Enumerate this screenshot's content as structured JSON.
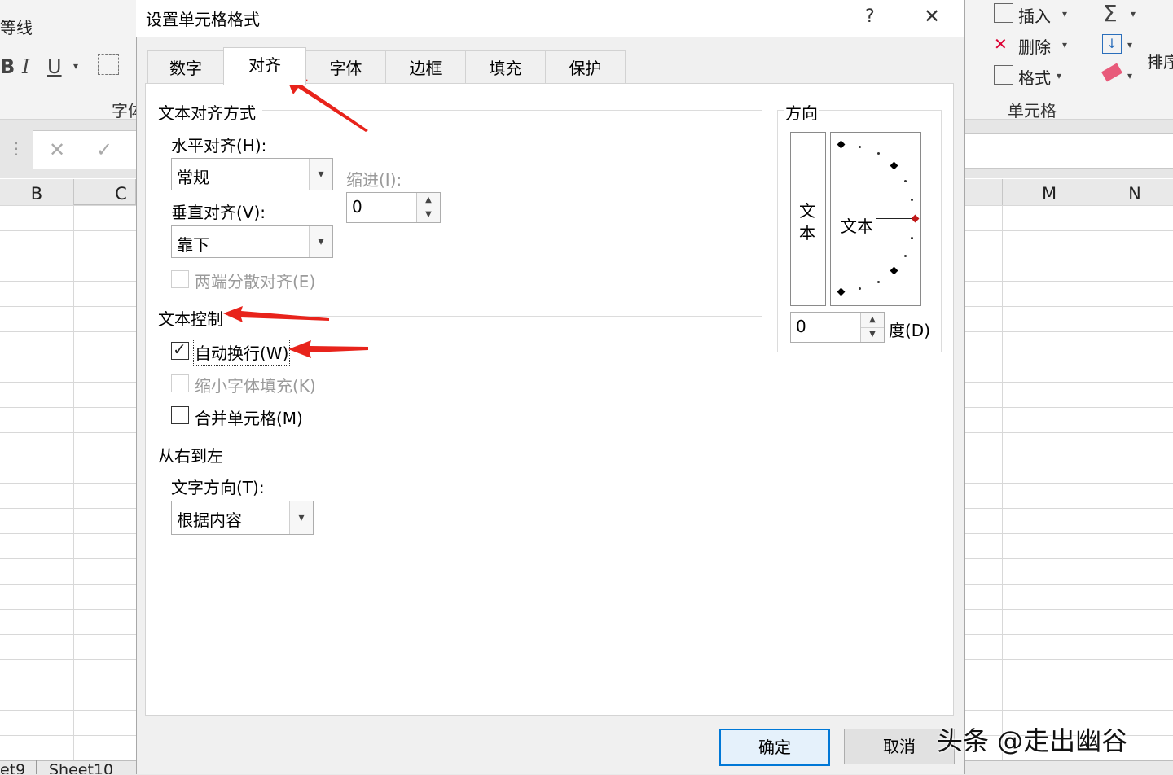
{
  "excel": {
    "font_name_fragment": "等线",
    "font_group_label_fragment": "字体",
    "ribbon_insert": "插入",
    "ribbon_delete": "删除",
    "ribbon_format": "格式",
    "cells_group_label": "单元格",
    "ribbon_sort_fragment": "排序",
    "col_headers_left": [
      "B",
      "C"
    ],
    "col_headers_right": [
      "M",
      "N"
    ],
    "sheet_tabs": [
      "et9",
      "Sheet10"
    ]
  },
  "dialog": {
    "title": "设置单元格格式",
    "help_glyph": "?",
    "close_glyph": "✕",
    "tabs": [
      "数字",
      "对齐",
      "字体",
      "边框",
      "填充",
      "保护"
    ],
    "active_tab": "对齐",
    "text_alignment": {
      "section_title": "文本对齐方式",
      "horizontal_label": "水平对齐(H):",
      "horizontal_value": "常规",
      "vertical_label": "垂直对齐(V):",
      "vertical_value": "靠下",
      "indent_label": "缩进(I):",
      "indent_value": "0",
      "justify_distributed_label": "两端分散对齐(E)"
    },
    "text_control": {
      "section_title": "文本控制",
      "wrap_text_label": "自动换行(W)",
      "wrap_text_checked": true,
      "shrink_to_fit_label": "缩小字体填充(K)",
      "merge_cells_label": "合并单元格(M)"
    },
    "right_to_left": {
      "section_title": "从右到左",
      "text_direction_label": "文字方向(T):",
      "text_direction_value": "根据内容"
    },
    "orientation": {
      "section_title": "方向",
      "vertical_text_1": "文",
      "vertical_text_2": "本",
      "dial_text": "文本",
      "degrees_value": "0",
      "degrees_label": "度(D)"
    },
    "ok_label": "确定",
    "cancel_label": "取消"
  },
  "watermark": "头条 @走出幽谷",
  "accent_colors": {
    "annotation_arrow": "#e8231b",
    "default_button_border": "#0078d7"
  }
}
